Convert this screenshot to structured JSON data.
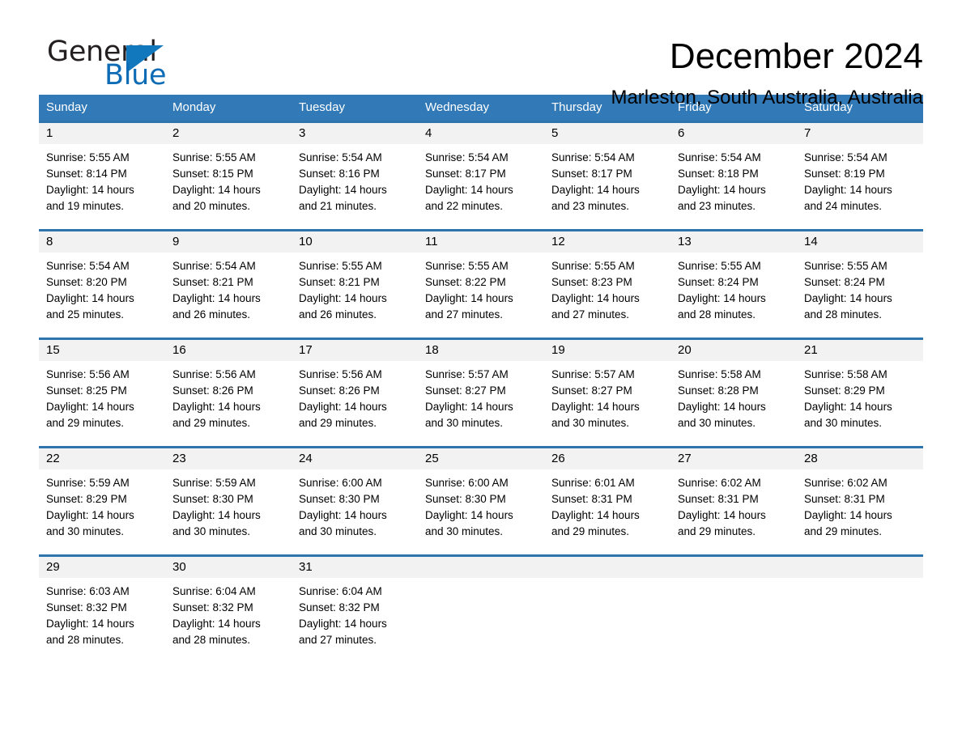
{
  "brand": {
    "name_part1": "General",
    "name_part2": "Blue",
    "accent_color": "#0d6cb5",
    "triangle_color": "#1178bd"
  },
  "header": {
    "title": "December 2024",
    "subtitle": "Marleston, South Australia, Australia"
  },
  "calendar": {
    "header_bg": "#3279b7",
    "row_divider_color": "#2e74ad",
    "day_band_bg": "#f2f2f2",
    "weekdays": [
      "Sunday",
      "Monday",
      "Tuesday",
      "Wednesday",
      "Thursday",
      "Friday",
      "Saturday"
    ],
    "weeks": [
      [
        {
          "day": "1",
          "sunrise": "Sunrise: 5:55 AM",
          "sunset": "Sunset: 8:14 PM",
          "daylight_line1": "Daylight: 14 hours",
          "daylight_line2": "and 19 minutes."
        },
        {
          "day": "2",
          "sunrise": "Sunrise: 5:55 AM",
          "sunset": "Sunset: 8:15 PM",
          "daylight_line1": "Daylight: 14 hours",
          "daylight_line2": "and 20 minutes."
        },
        {
          "day": "3",
          "sunrise": "Sunrise: 5:54 AM",
          "sunset": "Sunset: 8:16 PM",
          "daylight_line1": "Daylight: 14 hours",
          "daylight_line2": "and 21 minutes."
        },
        {
          "day": "4",
          "sunrise": "Sunrise: 5:54 AM",
          "sunset": "Sunset: 8:17 PM",
          "daylight_line1": "Daylight: 14 hours",
          "daylight_line2": "and 22 minutes."
        },
        {
          "day": "5",
          "sunrise": "Sunrise: 5:54 AM",
          "sunset": "Sunset: 8:17 PM",
          "daylight_line1": "Daylight: 14 hours",
          "daylight_line2": "and 23 minutes."
        },
        {
          "day": "6",
          "sunrise": "Sunrise: 5:54 AM",
          "sunset": "Sunset: 8:18 PM",
          "daylight_line1": "Daylight: 14 hours",
          "daylight_line2": "and 23 minutes."
        },
        {
          "day": "7",
          "sunrise": "Sunrise: 5:54 AM",
          "sunset": "Sunset: 8:19 PM",
          "daylight_line1": "Daylight: 14 hours",
          "daylight_line2": "and 24 minutes."
        }
      ],
      [
        {
          "day": "8",
          "sunrise": "Sunrise: 5:54 AM",
          "sunset": "Sunset: 8:20 PM",
          "daylight_line1": "Daylight: 14 hours",
          "daylight_line2": "and 25 minutes."
        },
        {
          "day": "9",
          "sunrise": "Sunrise: 5:54 AM",
          "sunset": "Sunset: 8:21 PM",
          "daylight_line1": "Daylight: 14 hours",
          "daylight_line2": "and 26 minutes."
        },
        {
          "day": "10",
          "sunrise": "Sunrise: 5:55 AM",
          "sunset": "Sunset: 8:21 PM",
          "daylight_line1": "Daylight: 14 hours",
          "daylight_line2": "and 26 minutes."
        },
        {
          "day": "11",
          "sunrise": "Sunrise: 5:55 AM",
          "sunset": "Sunset: 8:22 PM",
          "daylight_line1": "Daylight: 14 hours",
          "daylight_line2": "and 27 minutes."
        },
        {
          "day": "12",
          "sunrise": "Sunrise: 5:55 AM",
          "sunset": "Sunset: 8:23 PM",
          "daylight_line1": "Daylight: 14 hours",
          "daylight_line2": "and 27 minutes."
        },
        {
          "day": "13",
          "sunrise": "Sunrise: 5:55 AM",
          "sunset": "Sunset: 8:24 PM",
          "daylight_line1": "Daylight: 14 hours",
          "daylight_line2": "and 28 minutes."
        },
        {
          "day": "14",
          "sunrise": "Sunrise: 5:55 AM",
          "sunset": "Sunset: 8:24 PM",
          "daylight_line1": "Daylight: 14 hours",
          "daylight_line2": "and 28 minutes."
        }
      ],
      [
        {
          "day": "15",
          "sunrise": "Sunrise: 5:56 AM",
          "sunset": "Sunset: 8:25 PM",
          "daylight_line1": "Daylight: 14 hours",
          "daylight_line2": "and 29 minutes."
        },
        {
          "day": "16",
          "sunrise": "Sunrise: 5:56 AM",
          "sunset": "Sunset: 8:26 PM",
          "daylight_line1": "Daylight: 14 hours",
          "daylight_line2": "and 29 minutes."
        },
        {
          "day": "17",
          "sunrise": "Sunrise: 5:56 AM",
          "sunset": "Sunset: 8:26 PM",
          "daylight_line1": "Daylight: 14 hours",
          "daylight_line2": "and 29 minutes."
        },
        {
          "day": "18",
          "sunrise": "Sunrise: 5:57 AM",
          "sunset": "Sunset: 8:27 PM",
          "daylight_line1": "Daylight: 14 hours",
          "daylight_line2": "and 30 minutes."
        },
        {
          "day": "19",
          "sunrise": "Sunrise: 5:57 AM",
          "sunset": "Sunset: 8:27 PM",
          "daylight_line1": "Daylight: 14 hours",
          "daylight_line2": "and 30 minutes."
        },
        {
          "day": "20",
          "sunrise": "Sunrise: 5:58 AM",
          "sunset": "Sunset: 8:28 PM",
          "daylight_line1": "Daylight: 14 hours",
          "daylight_line2": "and 30 minutes."
        },
        {
          "day": "21",
          "sunrise": "Sunrise: 5:58 AM",
          "sunset": "Sunset: 8:29 PM",
          "daylight_line1": "Daylight: 14 hours",
          "daylight_line2": "and 30 minutes."
        }
      ],
      [
        {
          "day": "22",
          "sunrise": "Sunrise: 5:59 AM",
          "sunset": "Sunset: 8:29 PM",
          "daylight_line1": "Daylight: 14 hours",
          "daylight_line2": "and 30 minutes."
        },
        {
          "day": "23",
          "sunrise": "Sunrise: 5:59 AM",
          "sunset": "Sunset: 8:30 PM",
          "daylight_line1": "Daylight: 14 hours",
          "daylight_line2": "and 30 minutes."
        },
        {
          "day": "24",
          "sunrise": "Sunrise: 6:00 AM",
          "sunset": "Sunset: 8:30 PM",
          "daylight_line1": "Daylight: 14 hours",
          "daylight_line2": "and 30 minutes."
        },
        {
          "day": "25",
          "sunrise": "Sunrise: 6:00 AM",
          "sunset": "Sunset: 8:30 PM",
          "daylight_line1": "Daylight: 14 hours",
          "daylight_line2": "and 30 minutes."
        },
        {
          "day": "26",
          "sunrise": "Sunrise: 6:01 AM",
          "sunset": "Sunset: 8:31 PM",
          "daylight_line1": "Daylight: 14 hours",
          "daylight_line2": "and 29 minutes."
        },
        {
          "day": "27",
          "sunrise": "Sunrise: 6:02 AM",
          "sunset": "Sunset: 8:31 PM",
          "daylight_line1": "Daylight: 14 hours",
          "daylight_line2": "and 29 minutes."
        },
        {
          "day": "28",
          "sunrise": "Sunrise: 6:02 AM",
          "sunset": "Sunset: 8:31 PM",
          "daylight_line1": "Daylight: 14 hours",
          "daylight_line2": "and 29 minutes."
        }
      ],
      [
        {
          "day": "29",
          "sunrise": "Sunrise: 6:03 AM",
          "sunset": "Sunset: 8:32 PM",
          "daylight_line1": "Daylight: 14 hours",
          "daylight_line2": "and 28 minutes."
        },
        {
          "day": "30",
          "sunrise": "Sunrise: 6:04 AM",
          "sunset": "Sunset: 8:32 PM",
          "daylight_line1": "Daylight: 14 hours",
          "daylight_line2": "and 28 minutes."
        },
        {
          "day": "31",
          "sunrise": "Sunrise: 6:04 AM",
          "sunset": "Sunset: 8:32 PM",
          "daylight_line1": "Daylight: 14 hours",
          "daylight_line2": "and 27 minutes."
        },
        {
          "day": "",
          "sunrise": "",
          "sunset": "",
          "daylight_line1": "",
          "daylight_line2": ""
        },
        {
          "day": "",
          "sunrise": "",
          "sunset": "",
          "daylight_line1": "",
          "daylight_line2": ""
        },
        {
          "day": "",
          "sunrise": "",
          "sunset": "",
          "daylight_line1": "",
          "daylight_line2": ""
        },
        {
          "day": "",
          "sunrise": "",
          "sunset": "",
          "daylight_line1": "",
          "daylight_line2": ""
        }
      ]
    ]
  }
}
